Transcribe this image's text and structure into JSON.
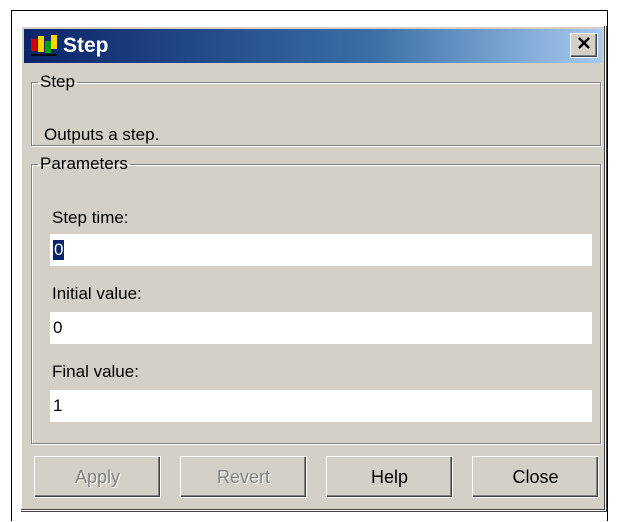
{
  "window": {
    "title": "Step",
    "close_label": "✕"
  },
  "step_group": {
    "legend": "Step",
    "description": "Outputs a step."
  },
  "parameters_group": {
    "legend": "Parameters",
    "fields": [
      {
        "label": "Step time:",
        "value": "0"
      },
      {
        "label": "Initial value:",
        "value": "0"
      },
      {
        "label": "Final value:",
        "value": "1"
      }
    ]
  },
  "buttons": {
    "apply": "Apply",
    "revert": "Revert",
    "help": "Help",
    "close": "Close"
  },
  "colors": {
    "titlebar_start": "#0a246a",
    "dialog_face": "#d4d0c8",
    "selection": "#0a246a"
  }
}
